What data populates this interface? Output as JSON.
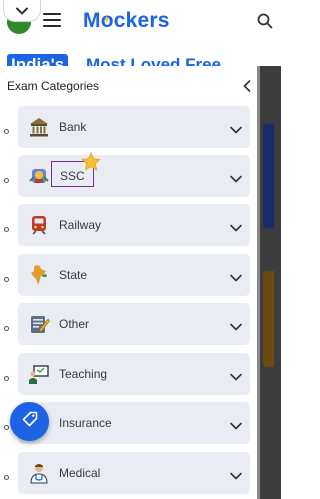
{
  "app": {
    "logo_prefix": "M",
    "logo_suffix": "ckers",
    "brand_color": "#1c63e6"
  },
  "hero": {
    "badge": "India's",
    "text": "Most Loved Free"
  },
  "drawer": {
    "title": "Exam Categories",
    "categories": [
      {
        "label": "Bank",
        "icon": "bank-building-icon"
      },
      {
        "label": "SSC",
        "icon": "ssc-emblem-icon",
        "highlighted": true
      },
      {
        "label": "Railway",
        "icon": "train-icon"
      },
      {
        "label": "State",
        "icon": "india-map-icon"
      },
      {
        "label": "Other",
        "icon": "document-pen-icon"
      },
      {
        "label": "Teaching",
        "icon": "teacher-board-icon"
      },
      {
        "label": "Insurance",
        "icon": "umbrella-icon"
      },
      {
        "label": "Medical",
        "icon": "doctor-icon"
      }
    ]
  },
  "icons": {
    "top_toggle": "chevron-down-icon",
    "menu": "hamburger-menu-icon",
    "search": "search-icon",
    "collapse": "chevron-left-icon",
    "row_expand": "chevron-down-icon",
    "favorite": "star-icon",
    "fab": "tag-icon"
  }
}
